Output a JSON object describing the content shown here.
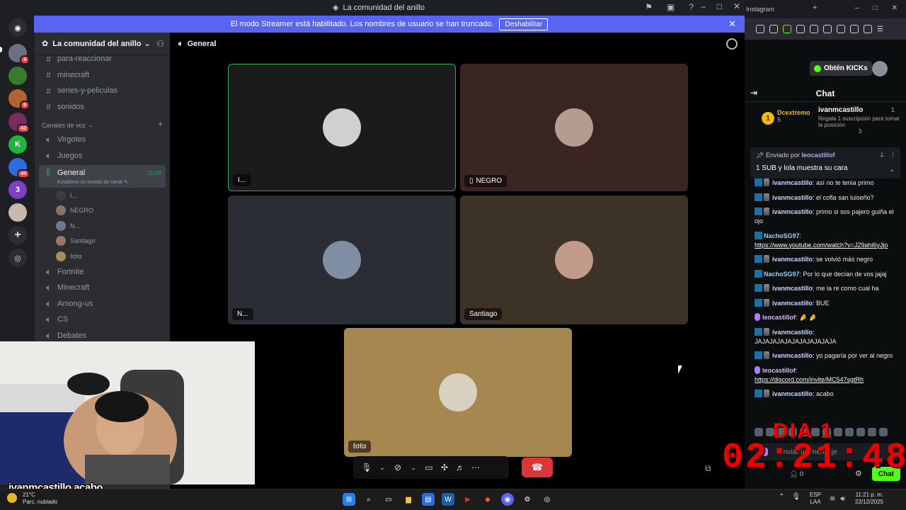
{
  "discord": {
    "window_title": "La comunidad del anillo",
    "streamer_bar": {
      "message": "El modo Streamer está habilitado. Los nombres de usuario se han truncado.",
      "button": "Deshabilitar"
    },
    "server_rail": [
      {
        "icon": "discord-logo-icon",
        "badge": ""
      },
      {
        "icon": "server-icon",
        "badge": "4"
      },
      {
        "icon": "server-icon",
        "badge": ""
      },
      {
        "icon": "server-icon",
        "badge": "6"
      },
      {
        "icon": "server-icon",
        "badge": "42"
      },
      {
        "icon": "server-icon",
        "badge": ""
      },
      {
        "icon": "server-icon",
        "badge": "44"
      },
      {
        "icon": "server-icon",
        "badge": ""
      },
      {
        "icon": "server-icon",
        "badge": ""
      }
    ],
    "server_name": "La comunidad del anillo",
    "text_channels": [
      "para-reaccionar",
      "minecraft",
      "series-y-peliculas",
      "sonidos"
    ],
    "voice_category": "Canales de voz",
    "voice_channels_top": [
      "Virgotes",
      "Juegos"
    ],
    "active_voice": {
      "name": "General",
      "timer": "15:09",
      "status_hint": "Establece un estado de canal",
      "users": [
        "I...",
        "NEGRO",
        "N...",
        "Santiago",
        "ℓσℓα"
      ]
    },
    "voice_channels_bottom": [
      "Fortnite",
      "Minecraft",
      "Among-us",
      "CS",
      "Debates"
    ],
    "voice_header": "General",
    "tiles": [
      {
        "name": "I...",
        "color": "#1b1b1d",
        "avatar": "#d0d0d0"
      },
      {
        "name": "NEGRO",
        "color": "#3a2522",
        "avatar": "#b39c90",
        "device": "phone-icon"
      },
      {
        "name": "N...",
        "color": "#2b2d35",
        "avatar": "#7f8ea3"
      },
      {
        "name": "Santiago",
        "color": "#3d3226",
        "avatar": "#c19a8c"
      },
      {
        "name": "ℓσℓα",
        "color": "#a6874f",
        "avatar": "#d8d1c2"
      }
    ]
  },
  "browser": {
    "tab_title": "Instagram",
    "kicks_button": "Obtén KICKs",
    "chat_title": "Chat",
    "leaderboard": {
      "first": {
        "rank": "1",
        "name": "Dcextremo",
        "count": "5"
      },
      "second": {
        "name": "ivanmcastillo",
        "count": "1",
        "desc": "Regala 1 suscripción para tomar la posición",
        "position": "3"
      }
    },
    "pinned": {
      "label": "Enviado por",
      "user": "leocastillof",
      "message": "1 SUB y lola muestra su cara"
    },
    "messages": [
      {
        "user": "ivanmcastillo",
        "text": "así no te tenia primo",
        "badge": "b"
      },
      {
        "user": "ivanmcastillo",
        "text": "el cofla san luiseño?",
        "badge": "b"
      },
      {
        "user": "ivanmcastillo",
        "text": "primo si sos pajero guiña el ojo",
        "badge": "b"
      },
      {
        "user": "NachoSG97",
        "text": "",
        "link": "https://www.youtube.com/watch?v=J29ahi6yJjo",
        "badge": "g"
      },
      {
        "user": "ivanmcastillo",
        "text": "se volvió más negro",
        "badge": "b"
      },
      {
        "user": "NachoSG97",
        "text": "Por lo que decían de vos jajaj",
        "badge": "g"
      },
      {
        "user": "ivanmcastillo",
        "text": "me la re como cual ha",
        "badge": "b"
      },
      {
        "user": "ivanmcastillo",
        "text": "BUE",
        "badge": "b"
      },
      {
        "user": "leocastillof",
        "text": "🤌 🤌",
        "badge": "p"
      },
      {
        "user": "ivanmcastillo",
        "text": "JAJAJAJAJAJAJAJAJAJAJA",
        "badge": "b",
        "block": true
      },
      {
        "user": "ivanmcastillo",
        "text": "yo pagaría por ver al negro",
        "badge": "b"
      },
      {
        "user": "leocastillof",
        "text": "",
        "link": "https://discord.com/invite/MC547sgtRh",
        "badge": "p"
      },
      {
        "user": "ivanmcastillo",
        "text": "acabo",
        "badge": "b"
      }
    ],
    "input_placeholder": "Enviar un mensaje",
    "viewers": "0",
    "send_button": "Chat"
  },
  "overlays": {
    "webcam_caption_user": "ivanmcastillo",
    "webcam_caption_text": "acabo",
    "day_label": "DIA 1",
    "clock": "02:21:48"
  },
  "taskbar": {
    "temperature": "21°C",
    "weather": "Parc. nublado",
    "lang_top": "ESP",
    "lang_bottom": "LAA",
    "time": "11:21 p. m.",
    "date": "22/12/2025"
  },
  "colors": {
    "discord_bg": "#1e1f22",
    "blurple": "#5865f2",
    "kick_green": "#53fc18",
    "hangup_red": "#da373c",
    "clock_red": "#ee0000"
  }
}
